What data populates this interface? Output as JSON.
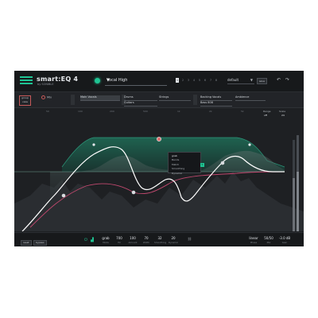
{
  "app": {
    "title": "smart:EQ 4",
    "subtitle": "by SONIBLE",
    "profile": "Vocal High",
    "snapshots": [
      "1",
      "2",
      "3",
      "4",
      "5",
      "6",
      "7",
      "8"
    ],
    "active_snapshot": "1",
    "preset": "default",
    "save_label": "save",
    "undo_icon": "undo-icon",
    "redo_icon": "redo-icon"
  },
  "group_bar": {
    "group_view_label": "group view",
    "mix_label": "Mix",
    "unknown_label": "",
    "groups": [
      {
        "name": "Main Vocals",
        "selected": true
      },
      {
        "name": "Drums",
        "selected": false
      },
      {
        "name": "Strings",
        "selected": false
      },
      {
        "name": "Guitars",
        "selected": false
      },
      {
        "name": "Backing Vocals",
        "selected": false
      },
      {
        "name": "Ambience",
        "selected": false
      },
      {
        "name": "Bass 808",
        "selected": false
      }
    ]
  },
  "graph": {
    "freq_labels": [
      "50",
      "100",
      "200",
      "500",
      "1k",
      "2k",
      "5k",
      "10k"
    ],
    "popup_items": [
      {
        "label": "grab",
        "on": true
      },
      {
        "label": "Bands",
        "on": false
      },
      {
        "label": "Match",
        "on": false
      },
      {
        "label": "Smoothing",
        "on": false
      },
      {
        "label": "Dynamic",
        "on": false
      }
    ],
    "badge": "S",
    "right_controls": [
      {
        "label": "Range",
        "value": "off"
      },
      {
        "label": "Scale",
        "value": "24"
      }
    ],
    "colors": {
      "accent": "#1fc493",
      "curve": "#ffffff",
      "pink": "#c0486e",
      "fill": "#1f5a4a"
    }
  },
  "bottom_bar": {
    "left_buttons": [
      "reset",
      "bypass"
    ],
    "params": [
      {
        "value": "grab",
        "label": "Mode"
      },
      {
        "value": "700",
        "label": "Hz"
      },
      {
        "value": "100",
        "label": "Amount"
      },
      {
        "value": "70",
        "label": "Width"
      },
      {
        "value": "32",
        "label": "Smoothing"
      },
      {
        "value": "20",
        "label": "Dynamic"
      }
    ],
    "mode": "linear",
    "mode_label": "Phase",
    "quality": "50/50",
    "quality_label": "Mix",
    "gain": "-3.0 dB",
    "gain_label": "Gain"
  }
}
